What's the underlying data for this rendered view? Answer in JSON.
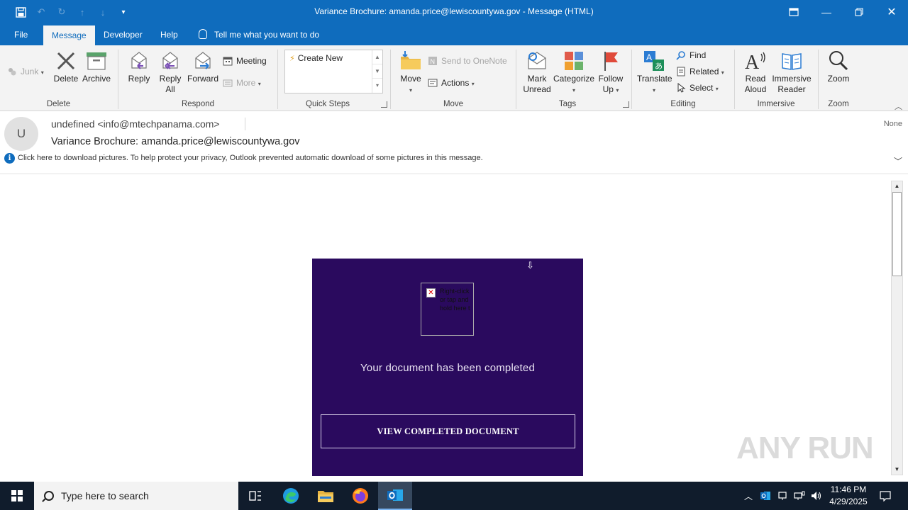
{
  "window": {
    "title": "Variance Brochure: amanda.price@lewiscountywa.gov  -  Message (HTML)"
  },
  "tabs": [
    "File",
    "Message",
    "Developer",
    "Help"
  ],
  "active_tab": "Message",
  "tell_me": "Tell me what you want to do",
  "ribbon": {
    "junk": "Junk",
    "delete": "Delete",
    "archive": "Archive",
    "group_delete": "Delete",
    "reply": "Reply",
    "reply_all_1": "Reply",
    "reply_all_2": "All",
    "forward": "Forward",
    "meeting": "Meeting",
    "more": "More",
    "group_respond": "Respond",
    "quick_steps_item": "Create New",
    "group_quick_steps": "Quick Steps",
    "move": "Move",
    "send_onenote": "Send to OneNote",
    "actions": "Actions",
    "group_move": "Move",
    "mark_unread_1": "Mark",
    "mark_unread_2": "Unread",
    "categorize": "Categorize",
    "follow_up_1": "Follow",
    "follow_up_2": "Up",
    "group_tags": "Tags",
    "translate": "Translate",
    "find": "Find",
    "related": "Related",
    "select": "Select",
    "group_editing": "Editing",
    "read_aloud_1": "Read",
    "read_aloud_2": "Aloud",
    "immersive_reader_1": "Immersive",
    "immersive_reader_2": "Reader",
    "group_immersive": "Immersive",
    "zoom": "Zoom",
    "group_zoom": "Zoom"
  },
  "message": {
    "avatar_initial": "U",
    "sender": "undefined <info@mtechpanama.com>",
    "subject": "Variance Brochure: amanda.price@lewiscountywa.gov",
    "importance": "None",
    "info_bar": "Click here to download pictures. To help protect your privacy, Outlook prevented automatic download of some pictures in this message.",
    "image_alt": "Right-click or tap and hold here t",
    "body_text": "Your document has been completed",
    "cta_button": "VIEW COMPLETED DOCUMENT"
  },
  "watermark": "ANY RUN",
  "taskbar": {
    "search_placeholder": "Type here to search",
    "time": "11:46 PM",
    "date": "4/29/2025"
  },
  "colors": {
    "accent": "#0f6cbd",
    "card_bg": "#2a0a5e",
    "taskbar_bg": "#101c2c"
  }
}
